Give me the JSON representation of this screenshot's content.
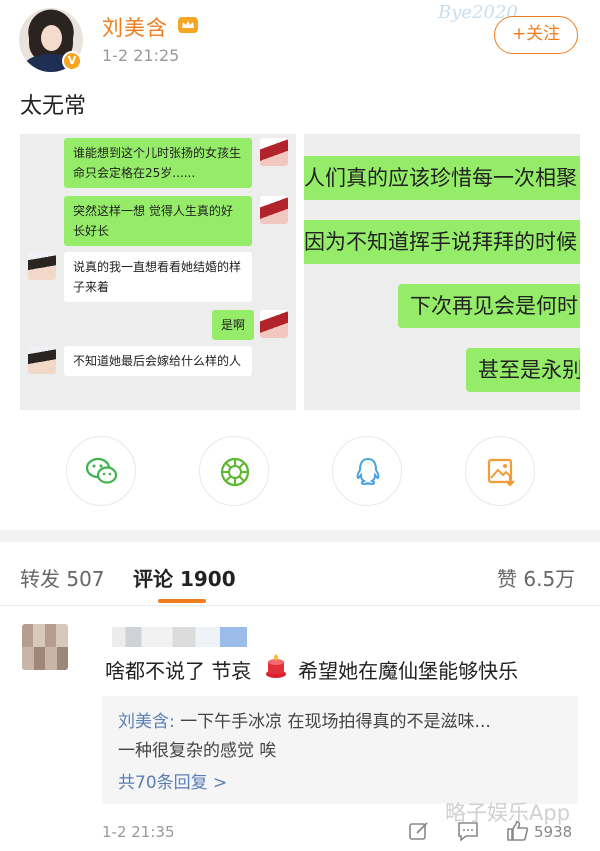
{
  "post": {
    "username": "刘美含",
    "time": "1-2 21:25",
    "follow_label": "+关注",
    "text": "太无常",
    "verified_badge": "V",
    "watermark_top": "Bye2020"
  },
  "images": {
    "left_chat": [
      {
        "side": "right",
        "text": "谁能想到这个儿时张扬的女孩生命只会定格在25岁......"
      },
      {
        "side": "right",
        "text": "突然这样一想 觉得人生真的好长好长"
      },
      {
        "side": "left",
        "text": "说真的我一直想看看她结婚的样子来着"
      },
      {
        "side": "right",
        "text": "是啊"
      },
      {
        "side": "left",
        "text": "不知道她最后会嫁给什么样的人"
      }
    ],
    "right_chat": [
      {
        "text": "人们真的应该珍惜每一次相聚"
      },
      {
        "text": "因为不知道挥手说拜拜的时候"
      },
      {
        "text": "下次再见会是何时"
      },
      {
        "text": "甚至是永别"
      }
    ]
  },
  "share": [
    "wechat-icon",
    "moments-icon",
    "qq-icon",
    "save-image-icon"
  ],
  "tabs": {
    "repost": "转发 507",
    "comment": "评论 1900",
    "like": "赞 6.5万"
  },
  "comment": {
    "text_before": "啥都不说了 节哀",
    "text_after": "希望她在魔仙堡能够快乐",
    "reply": {
      "name": "刘美含:",
      "line1": "一下午手冰凉  在现场拍得真的不是滋味...",
      "line2": "一种很复杂的感觉  唉",
      "more": "共70条回复 >"
    },
    "time": "1-2 21:35",
    "likes": "5938"
  },
  "watermark_bottom": "略子娱乐App",
  "colors": {
    "accent": "#f07d1c",
    "link": "#5a7fb5",
    "wechat_green": "#95ec69"
  }
}
